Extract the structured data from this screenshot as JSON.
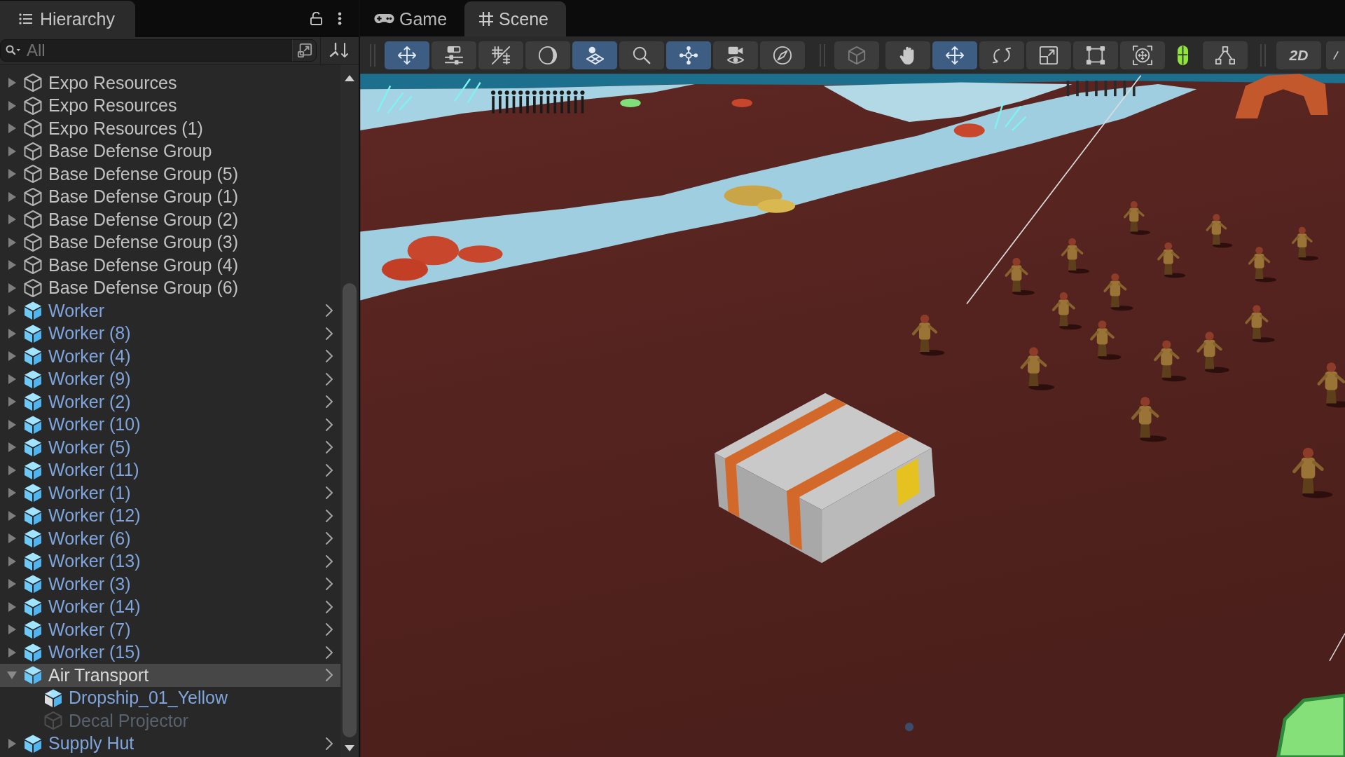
{
  "hierarchy": {
    "tab": {
      "label": "Hierarchy",
      "selected": true
    },
    "search": {
      "placeholder": "All"
    },
    "items": [
      {
        "label": "Expo Resources",
        "kind": "object",
        "expanded": false,
        "selected": false,
        "enabled": true,
        "open_arrow": false
      },
      {
        "label": "Expo Resources",
        "kind": "object",
        "expanded": false,
        "selected": false,
        "enabled": true,
        "open_arrow": false
      },
      {
        "label": "Expo Resources (1)",
        "kind": "object",
        "expanded": false,
        "selected": false,
        "enabled": true,
        "open_arrow": false
      },
      {
        "label": "Base Defense Group",
        "kind": "object",
        "expanded": false,
        "selected": false,
        "enabled": true,
        "open_arrow": false
      },
      {
        "label": "Base Defense Group (5)",
        "kind": "object",
        "expanded": false,
        "selected": false,
        "enabled": true,
        "open_arrow": false
      },
      {
        "label": "Base Defense Group (1)",
        "kind": "object",
        "expanded": false,
        "selected": false,
        "enabled": true,
        "open_arrow": false
      },
      {
        "label": "Base Defense Group (2)",
        "kind": "object",
        "expanded": false,
        "selected": false,
        "enabled": true,
        "open_arrow": false
      },
      {
        "label": "Base Defense Group (3)",
        "kind": "object",
        "expanded": false,
        "selected": false,
        "enabled": true,
        "open_arrow": false
      },
      {
        "label": "Base Defense Group (4)",
        "kind": "object",
        "expanded": false,
        "selected": false,
        "enabled": true,
        "open_arrow": false
      },
      {
        "label": "Base Defense Group (6)",
        "kind": "object",
        "expanded": false,
        "selected": false,
        "enabled": true,
        "open_arrow": false
      },
      {
        "label": "Worker",
        "kind": "prefab",
        "expanded": false,
        "selected": false,
        "enabled": true,
        "open_arrow": true
      },
      {
        "label": "Worker (8)",
        "kind": "prefab",
        "expanded": false,
        "selected": false,
        "enabled": true,
        "open_arrow": true
      },
      {
        "label": "Worker (4)",
        "kind": "prefab",
        "expanded": false,
        "selected": false,
        "enabled": true,
        "open_arrow": true
      },
      {
        "label": "Worker (9)",
        "kind": "prefab",
        "expanded": false,
        "selected": false,
        "enabled": true,
        "open_arrow": true
      },
      {
        "label": "Worker (2)",
        "kind": "prefab",
        "expanded": false,
        "selected": false,
        "enabled": true,
        "open_arrow": true
      },
      {
        "label": "Worker (10)",
        "kind": "prefab",
        "expanded": false,
        "selected": false,
        "enabled": true,
        "open_arrow": true
      },
      {
        "label": "Worker (5)",
        "kind": "prefab",
        "expanded": false,
        "selected": false,
        "enabled": true,
        "open_arrow": true
      },
      {
        "label": "Worker (11)",
        "kind": "prefab",
        "expanded": false,
        "selected": false,
        "enabled": true,
        "open_arrow": true
      },
      {
        "label": "Worker (1)",
        "kind": "prefab",
        "expanded": false,
        "selected": false,
        "enabled": true,
        "open_arrow": true
      },
      {
        "label": "Worker (12)",
        "kind": "prefab",
        "expanded": false,
        "selected": false,
        "enabled": true,
        "open_arrow": true
      },
      {
        "label": "Worker (6)",
        "kind": "prefab",
        "expanded": false,
        "selected": false,
        "enabled": true,
        "open_arrow": true
      },
      {
        "label": "Worker (13)",
        "kind": "prefab",
        "expanded": false,
        "selected": false,
        "enabled": true,
        "open_arrow": true
      },
      {
        "label": "Worker (3)",
        "kind": "prefab",
        "expanded": false,
        "selected": false,
        "enabled": true,
        "open_arrow": true
      },
      {
        "label": "Worker (14)",
        "kind": "prefab",
        "expanded": false,
        "selected": false,
        "enabled": true,
        "open_arrow": true
      },
      {
        "label": "Worker (7)",
        "kind": "prefab",
        "expanded": false,
        "selected": false,
        "enabled": true,
        "open_arrow": true
      },
      {
        "label": "Worker (15)",
        "kind": "prefab",
        "expanded": false,
        "selected": false,
        "enabled": true,
        "open_arrow": true
      },
      {
        "label": "Air Transport",
        "kind": "prefab",
        "expanded": true,
        "selected": true,
        "enabled": true,
        "open_arrow": true,
        "children": [
          {
            "label": "Dropship_01_Yellow",
            "kind": "variant",
            "selected": false,
            "enabled": true,
            "open_arrow": false
          },
          {
            "label": "Decal Projector",
            "kind": "object",
            "selected": false,
            "enabled": false,
            "open_arrow": false
          }
        ]
      },
      {
        "label": "Supply Hut",
        "kind": "prefab",
        "expanded": false,
        "selected": false,
        "enabled": true,
        "open_arrow": true
      }
    ]
  },
  "scene": {
    "tabs": [
      {
        "label": "Game",
        "selected": false
      },
      {
        "label": "Scene",
        "selected": true
      }
    ],
    "toolbar": {
      "sections": [
        {
          "buttons": [
            {
              "on": true
            },
            {
              "on": false
            },
            {
              "on": false
            },
            {
              "on": false
            },
            {
              "on": true
            },
            {
              "on": false
            },
            {
              "on": true
            },
            {
              "on": false
            },
            {
              "on": false
            }
          ]
        },
        {
          "buttons": [
            {
              "kind": "button",
              "on": false
            },
            {
              "kind": "button",
              "on": false
            },
            {
              "kind": "button",
              "on": true
            },
            {
              "kind": "button",
              "on": false
            },
            {
              "kind": "button",
              "on": false
            },
            {
              "kind": "button",
              "on": false
            },
            {
              "kind": "button",
              "on": false
            },
            {
              "kind": "plain",
              "on": false
            },
            {
              "kind": "button",
              "on": false
            }
          ]
        },
        {
          "buttons": [
            {
              "label": "2D",
              "on": false
            },
            {
              "on": false
            }
          ]
        }
      ]
    }
  }
}
